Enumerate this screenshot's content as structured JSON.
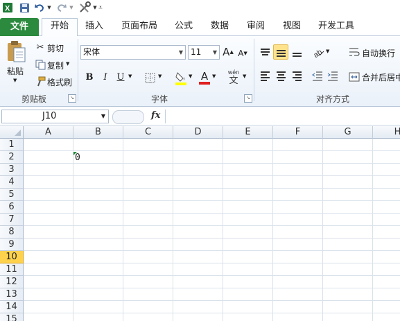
{
  "quick_access": {
    "customize_label": ""
  },
  "tabs": [
    "文件",
    "开始",
    "插入",
    "页面布局",
    "公式",
    "数据",
    "审阅",
    "视图",
    "开发工具"
  ],
  "clipboard": {
    "paste_label": "粘贴",
    "cut_label": "剪切",
    "copy_label": "复制",
    "format_painter_label": "格式刷",
    "group_label": "剪贴板"
  },
  "font": {
    "font_name": "宋体",
    "font_size": "11",
    "bold": "B",
    "italic": "I",
    "underline": "U",
    "grow": "A",
    "shrink": "A",
    "font_color_glyph": "A",
    "wen_top": "wén",
    "wen_char": "文",
    "group_label": "字体"
  },
  "alignment": {
    "wrap_text_label": "自动换行",
    "merge_center_label": "合并后居中",
    "group_label": "对齐方式"
  },
  "formula_bar": {
    "name_box": "J10",
    "fx": "fx"
  },
  "columns": [
    "A",
    "B",
    "C",
    "D",
    "E",
    "F",
    "G",
    "H"
  ],
  "rows": [
    "1",
    "2",
    "3",
    "4",
    "5",
    "6",
    "7",
    "8",
    "9",
    "10",
    "11",
    "12",
    "13",
    "14",
    "15"
  ],
  "selected_row": "10",
  "cells": {
    "B2": "0"
  },
  "colors": {
    "file_tab": "#2b8a3e",
    "selected_header": "#ffd24d",
    "error_triangle": "#1e8a3a"
  }
}
